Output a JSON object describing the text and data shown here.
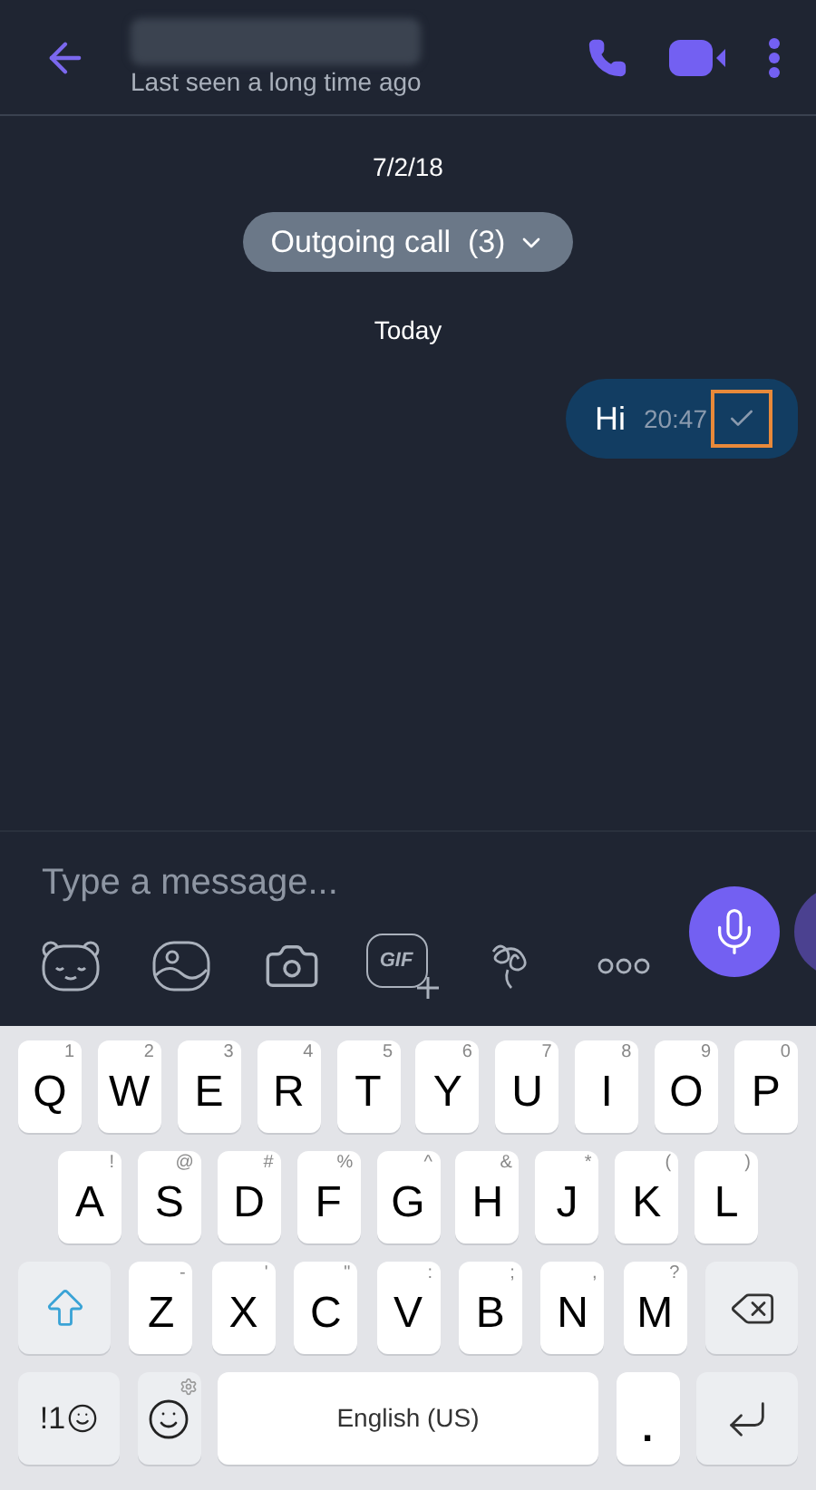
{
  "header": {
    "status": "Last seen a long time ago"
  },
  "timeline": [
    {
      "kind": "date",
      "text": "7/2/18"
    },
    {
      "kind": "call_summary",
      "text": "Outgoing call  (3)"
    },
    {
      "kind": "date",
      "text": "Today"
    },
    {
      "kind": "outgoing_message",
      "text": "Hi",
      "time": "20:47",
      "highlighted": true
    }
  ],
  "composer": {
    "placeholder": "Type a message...",
    "tools": [
      {
        "kind": "sticker"
      },
      {
        "kind": "gallery"
      },
      {
        "kind": "camera"
      },
      {
        "kind": "gif",
        "label": "GIF"
      },
      {
        "kind": "doodle"
      },
      {
        "kind": "more"
      }
    ]
  },
  "keyboard": {
    "rows": [
      [
        {
          "kind": "letter",
          "label": "Q",
          "hint": "1"
        },
        {
          "kind": "letter",
          "label": "W",
          "hint": "2"
        },
        {
          "kind": "letter",
          "label": "E",
          "hint": "3"
        },
        {
          "kind": "letter",
          "label": "R",
          "hint": "4"
        },
        {
          "kind": "letter",
          "label": "T",
          "hint": "5"
        },
        {
          "kind": "letter",
          "label": "Y",
          "hint": "6"
        },
        {
          "kind": "letter",
          "label": "U",
          "hint": "7"
        },
        {
          "kind": "letter",
          "label": "I",
          "hint": "8"
        },
        {
          "kind": "letter",
          "label": "O",
          "hint": "9"
        },
        {
          "kind": "letter",
          "label": "P",
          "hint": "0"
        }
      ],
      [
        {
          "kind": "letter",
          "label": "A",
          "hint": "!"
        },
        {
          "kind": "letter",
          "label": "S",
          "hint": "@"
        },
        {
          "kind": "letter",
          "label": "D",
          "hint": "#"
        },
        {
          "kind": "letter",
          "label": "F",
          "hint": "%"
        },
        {
          "kind": "letter",
          "label": "G",
          "hint": "^"
        },
        {
          "kind": "letter",
          "label": "H",
          "hint": "&"
        },
        {
          "kind": "letter",
          "label": "J",
          "hint": "*"
        },
        {
          "kind": "letter",
          "label": "K",
          "hint": "("
        },
        {
          "kind": "letter",
          "label": "L",
          "hint": ")"
        }
      ],
      [
        {
          "kind": "shift"
        },
        {
          "kind": "letter",
          "label": "Z",
          "hint": "-"
        },
        {
          "kind": "letter",
          "label": "X",
          "hint": "'"
        },
        {
          "kind": "letter",
          "label": "C",
          "hint": "\""
        },
        {
          "kind": "letter",
          "label": "V",
          "hint": ":"
        },
        {
          "kind": "letter",
          "label": "B",
          "hint": ";"
        },
        {
          "kind": "letter",
          "label": "N",
          "hint": ","
        },
        {
          "kind": "letter",
          "label": "M",
          "hint": "?"
        },
        {
          "kind": "backspace"
        }
      ]
    ],
    "bottom_row": {
      "symbols_key": "!1",
      "space_key": "English (US)",
      "period_key": "."
    }
  }
}
